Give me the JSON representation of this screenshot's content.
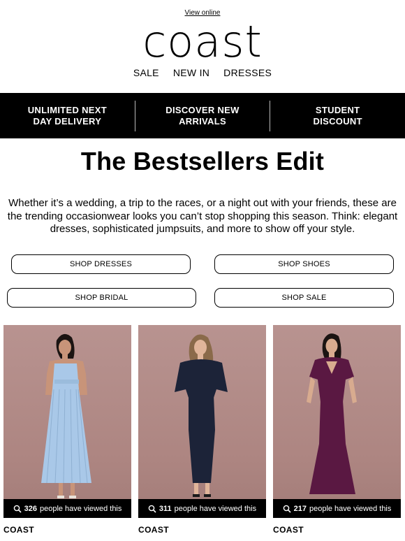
{
  "header": {
    "view_online": "View online",
    "logo": "coast",
    "nav": [
      "SALE",
      "NEW IN",
      "DRESSES"
    ]
  },
  "promo_bar": [
    {
      "line1": "UNLIMITED NEXT",
      "line2": "DAY DELIVERY"
    },
    {
      "line1": "DISCOVER NEW",
      "line2": "ARRIVALS"
    },
    {
      "line1": "STUDENT",
      "line2": "DISCOUNT"
    }
  ],
  "headline": "The Bestsellers Edit",
  "intro": "Whether it’s a wedding, a trip to the races, or a night out with your friends, these are the trending occasionwear looks you can’t stop shopping this season. Think: elegant dresses, sophisticated jumpsuits, and more to show off your style.",
  "buttons": {
    "dresses": "SHOP DRESSES",
    "shoes": "SHOP SHOES",
    "bridal": "SHOP BRIDAL",
    "sale": "SHOP SALE"
  },
  "products": [
    {
      "count": "326",
      "viewed_text": "people have viewed this",
      "brand": "COAST",
      "dress_color": "#a9c8e8"
    },
    {
      "count": "311",
      "viewed_text": "people have viewed this",
      "brand": "COAST",
      "dress_color": "#1c2338"
    },
    {
      "count": "217",
      "viewed_text": "people have viewed this",
      "brand": "COAST",
      "dress_color": "#5a1842"
    }
  ]
}
